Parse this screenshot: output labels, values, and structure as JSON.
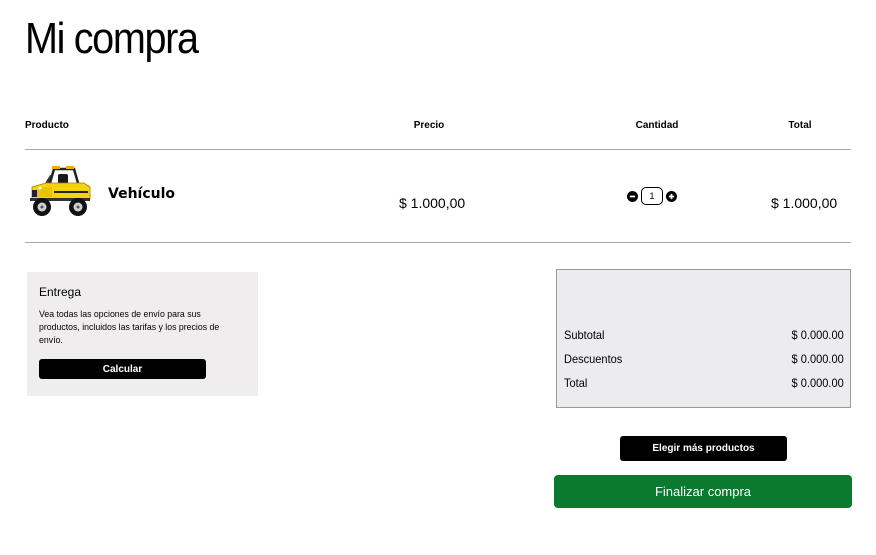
{
  "page": {
    "title": "Mi compra"
  },
  "table": {
    "headers": {
      "product": "Producto",
      "price": "Precio",
      "quantity": "Cantidad",
      "total": "Total"
    },
    "items": [
      {
        "name": "Vehículo",
        "image_icon": "yellow-toy-jeep",
        "price": "$ 1.000,00",
        "quantity": "1",
        "total": "$ 1.000,00"
      }
    ]
  },
  "delivery": {
    "title": "Entrega",
    "description": "Vea todas las opciones de envío para sus productos, incluidos las tarifas y los precios de envío.",
    "button_label": "Calcular"
  },
  "summary": {
    "rows": [
      {
        "label": "Subtotal",
        "value": "$ 0.000.00"
      },
      {
        "label": "Descuentos",
        "value": "$ 0.000.00"
      },
      {
        "label": "Total",
        "value": "$ 0.000.00"
      }
    ]
  },
  "actions": {
    "more_products_label": "Elegir más productos",
    "checkout_label": "Finalizar compra"
  },
  "colors": {
    "checkout_green": "#0a7a2f",
    "delivery_bg": "#efeded",
    "summary_bg": "#ececee",
    "vehicle_yellow": "#f5d40f"
  }
}
